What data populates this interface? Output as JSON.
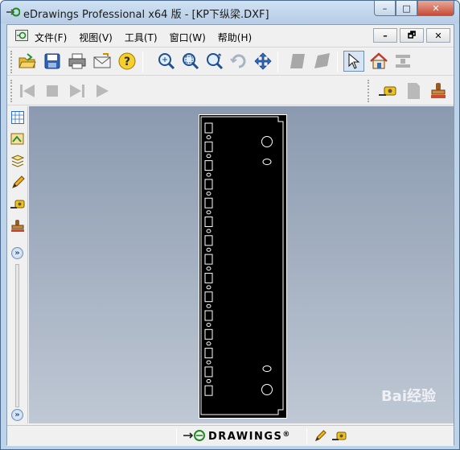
{
  "window": {
    "title": "eDrawings Professional x64 版 - [KP下纵梁.DXF]",
    "controls": {
      "minimize": "–",
      "maximize": "□",
      "close": "✕"
    }
  },
  "menubar": {
    "items": [
      {
        "label": "文件(F)"
      },
      {
        "label": "视图(V)"
      },
      {
        "label": "工具(T)"
      },
      {
        "label": "窗口(W)"
      },
      {
        "label": "帮助(H)"
      }
    ],
    "doc_controls": {
      "minimize": "–",
      "restore": "🗗",
      "close": "✕"
    }
  },
  "toolbar": {
    "buttons": [
      {
        "icon": "open-folder-icon"
      },
      {
        "icon": "save-icon"
      },
      {
        "icon": "print-icon"
      },
      {
        "icon": "send-mail-icon"
      },
      {
        "icon": "help-icon"
      },
      {
        "icon": "zoom-to-fit-icon"
      },
      {
        "icon": "zoom-area-icon"
      },
      {
        "icon": "zoom-in-out-icon"
      },
      {
        "icon": "rotate-icon"
      },
      {
        "icon": "pan-icon"
      },
      {
        "icon": "shaded-view-icon"
      },
      {
        "icon": "perspective-icon"
      },
      {
        "icon": "select-arrow-icon",
        "active": true
      },
      {
        "icon": "home-view-icon"
      },
      {
        "icon": "explode-icon"
      }
    ]
  },
  "playback": {
    "buttons": [
      {
        "icon": "first-frame-icon"
      },
      {
        "icon": "stop-icon"
      },
      {
        "icon": "next-frame-icon"
      },
      {
        "icon": "play-icon"
      }
    ],
    "right": [
      {
        "icon": "measure-icon"
      },
      {
        "icon": "markup-icon"
      },
      {
        "icon": "stamp-icon"
      }
    ]
  },
  "left_panel": {
    "buttons": [
      {
        "icon": "sheet-grid-icon"
      },
      {
        "icon": "components-icon"
      },
      {
        "icon": "layers-icon"
      },
      {
        "icon": "pencil-icon"
      },
      {
        "icon": "measure-icon"
      },
      {
        "icon": "stamp-icon"
      }
    ],
    "expand_top": "»",
    "expand_bottom": "»"
  },
  "statusbar": {
    "brand": "DRAWINGS",
    "brand_symbol": "®"
  },
  "watermark": "Bai经验",
  "colors": {
    "viewport_top": "#8b9ab0",
    "viewport_bottom": "#bfc8d4",
    "sheet": "#000000",
    "outline": "#ffffff"
  }
}
